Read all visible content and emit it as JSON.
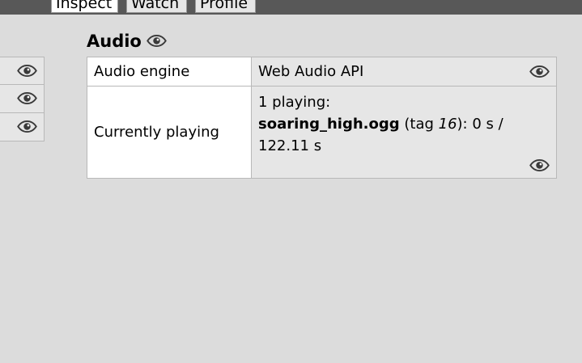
{
  "tabs": [
    {
      "label": "Inspect"
    },
    {
      "label": "Watch"
    },
    {
      "label": "Profile"
    }
  ],
  "section": {
    "title": "Audio",
    "title_icon": "eye-icon"
  },
  "properties": [
    {
      "key": "Audio engine",
      "value": "Web Audio API"
    },
    {
      "key": "Currently playing",
      "line1": "1 playing:",
      "file": "soaring_high.ogg",
      "tag_prefix": " (tag ",
      "tag": "16",
      "tag_suffix": "): 0 s / 122.11 s"
    }
  ],
  "colors": {
    "background": "#dcdcdc",
    "topbar": "#585858",
    "value_cell": "#e6e6e6",
    "key_cell": "#ffffff",
    "border": "#b8b8b8"
  }
}
